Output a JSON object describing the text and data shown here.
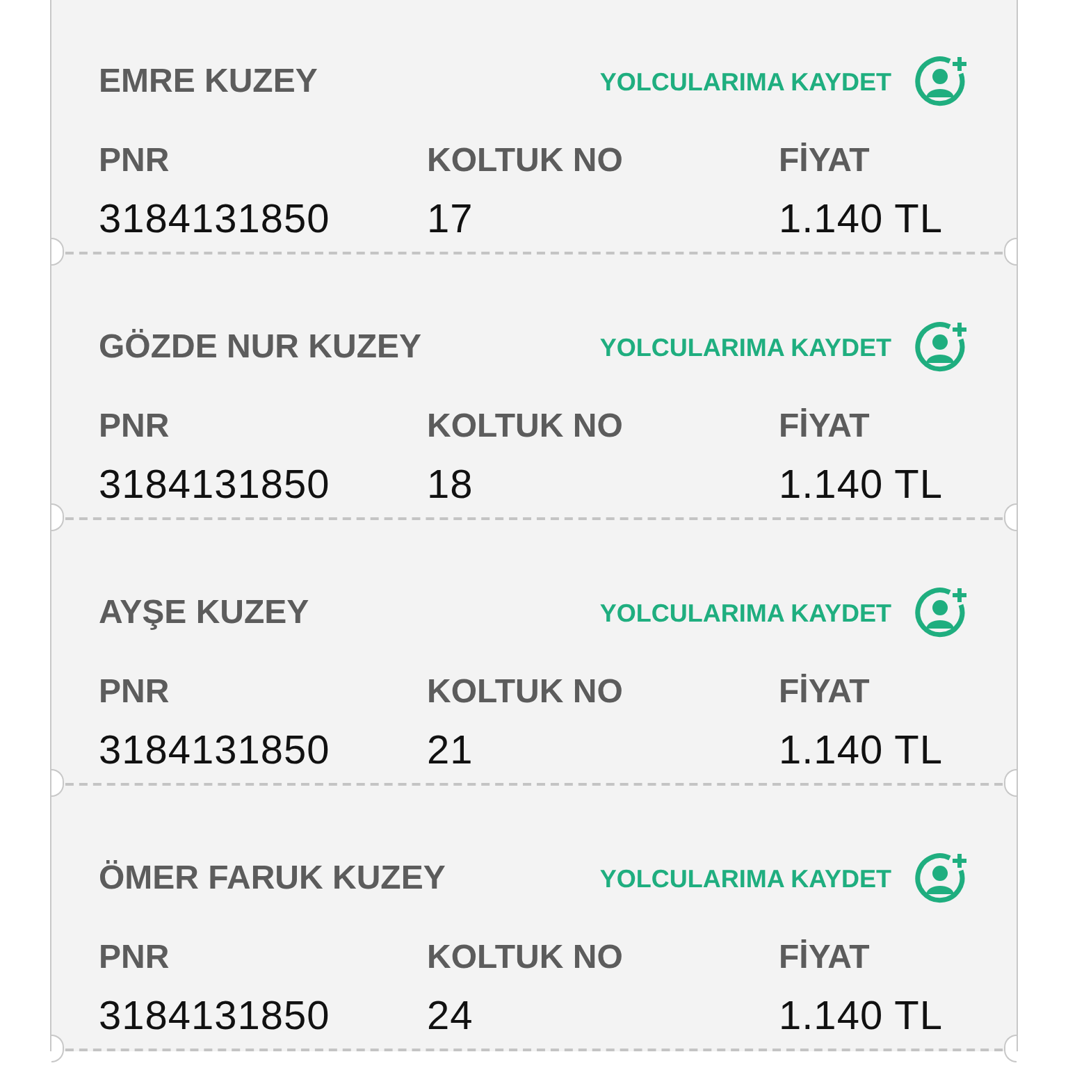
{
  "passengers": [
    {
      "name": "EMRE KUZEY",
      "save_action": "YOLCULARIMA KAYDET",
      "pnr_label": "PNR",
      "seat_label": "KOLTUK NO",
      "price_label": "FİYAT",
      "pnr": "3184131850",
      "seat": "17",
      "price": "1.140 TL"
    },
    {
      "name": "GÖZDE NUR KUZEY",
      "save_action": "YOLCULARIMA KAYDET",
      "pnr_label": "PNR",
      "seat_label": "KOLTUK NO",
      "price_label": "FİYAT",
      "pnr": "3184131850",
      "seat": "18",
      "price": "1.140 TL"
    },
    {
      "name": "AYŞE KUZEY",
      "save_action": "YOLCULARIMA KAYDET",
      "pnr_label": "PNR",
      "seat_label": "KOLTUK NO",
      "price_label": "FİYAT",
      "pnr": "3184131850",
      "seat": "21",
      "price": "1.140 TL"
    },
    {
      "name": "ÖMER FARUK KUZEY",
      "save_action": "YOLCULARIMA KAYDET",
      "pnr_label": "PNR",
      "seat_label": "KOLTUK NO",
      "price_label": "FİYAT",
      "pnr": "3184131850",
      "seat": "24",
      "price": "1.140 TL"
    }
  ]
}
